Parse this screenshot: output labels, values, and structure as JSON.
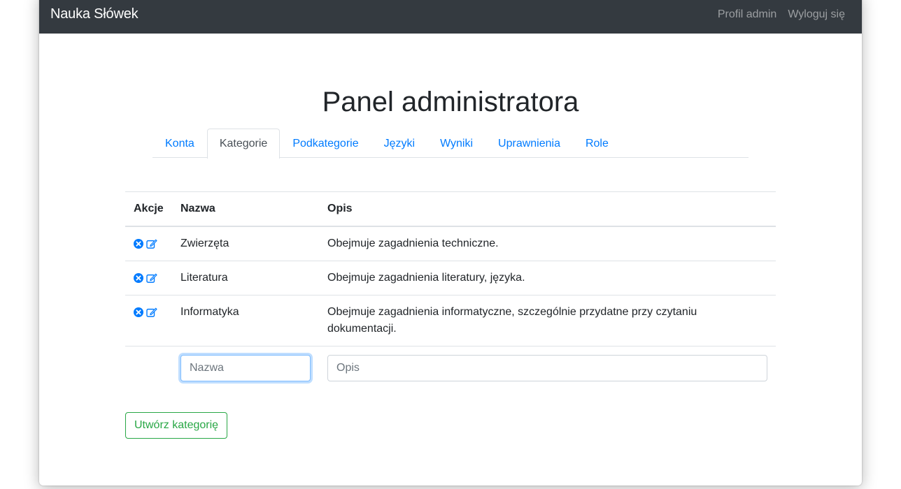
{
  "navbar": {
    "brand": "Nauka Słówek",
    "links": [
      "Profil admin",
      "Wyloguj się"
    ]
  },
  "page": {
    "title": "Panel administratora"
  },
  "tabs": [
    {
      "label": "Konta",
      "active": false
    },
    {
      "label": "Kategorie",
      "active": true
    },
    {
      "label": "Podkategorie",
      "active": false
    },
    {
      "label": "Języki",
      "active": false
    },
    {
      "label": "Wyniki",
      "active": false
    },
    {
      "label": "Uprawnienia",
      "active": false
    },
    {
      "label": "Role",
      "active": false
    }
  ],
  "table": {
    "headers": [
      "Akcje",
      "Nazwa",
      "Opis"
    ],
    "rows": [
      {
        "name": "Zwierzęta",
        "description": "Obejmuje zagadnienia techniczne."
      },
      {
        "name": "Literatura",
        "description": "Obejmuje zagadnienia literatury, języka."
      },
      {
        "name": "Informatyka",
        "description": "Obejmuje zagadnienia informatyczne, szczególnie przydatne przy czytaniu dokumentacji."
      }
    ],
    "icons": [
      "delete-circle-icon",
      "edit-icon"
    ]
  },
  "form": {
    "name_placeholder": "Nazwa",
    "name_value": "",
    "description_placeholder": "Opis",
    "description_value": "",
    "submit_label": "Utwórz kategorię"
  },
  "colors": {
    "navbar_bg": "#343a40",
    "link": "#007bff",
    "success": "#28a745",
    "focus_border": "#80bdff"
  }
}
